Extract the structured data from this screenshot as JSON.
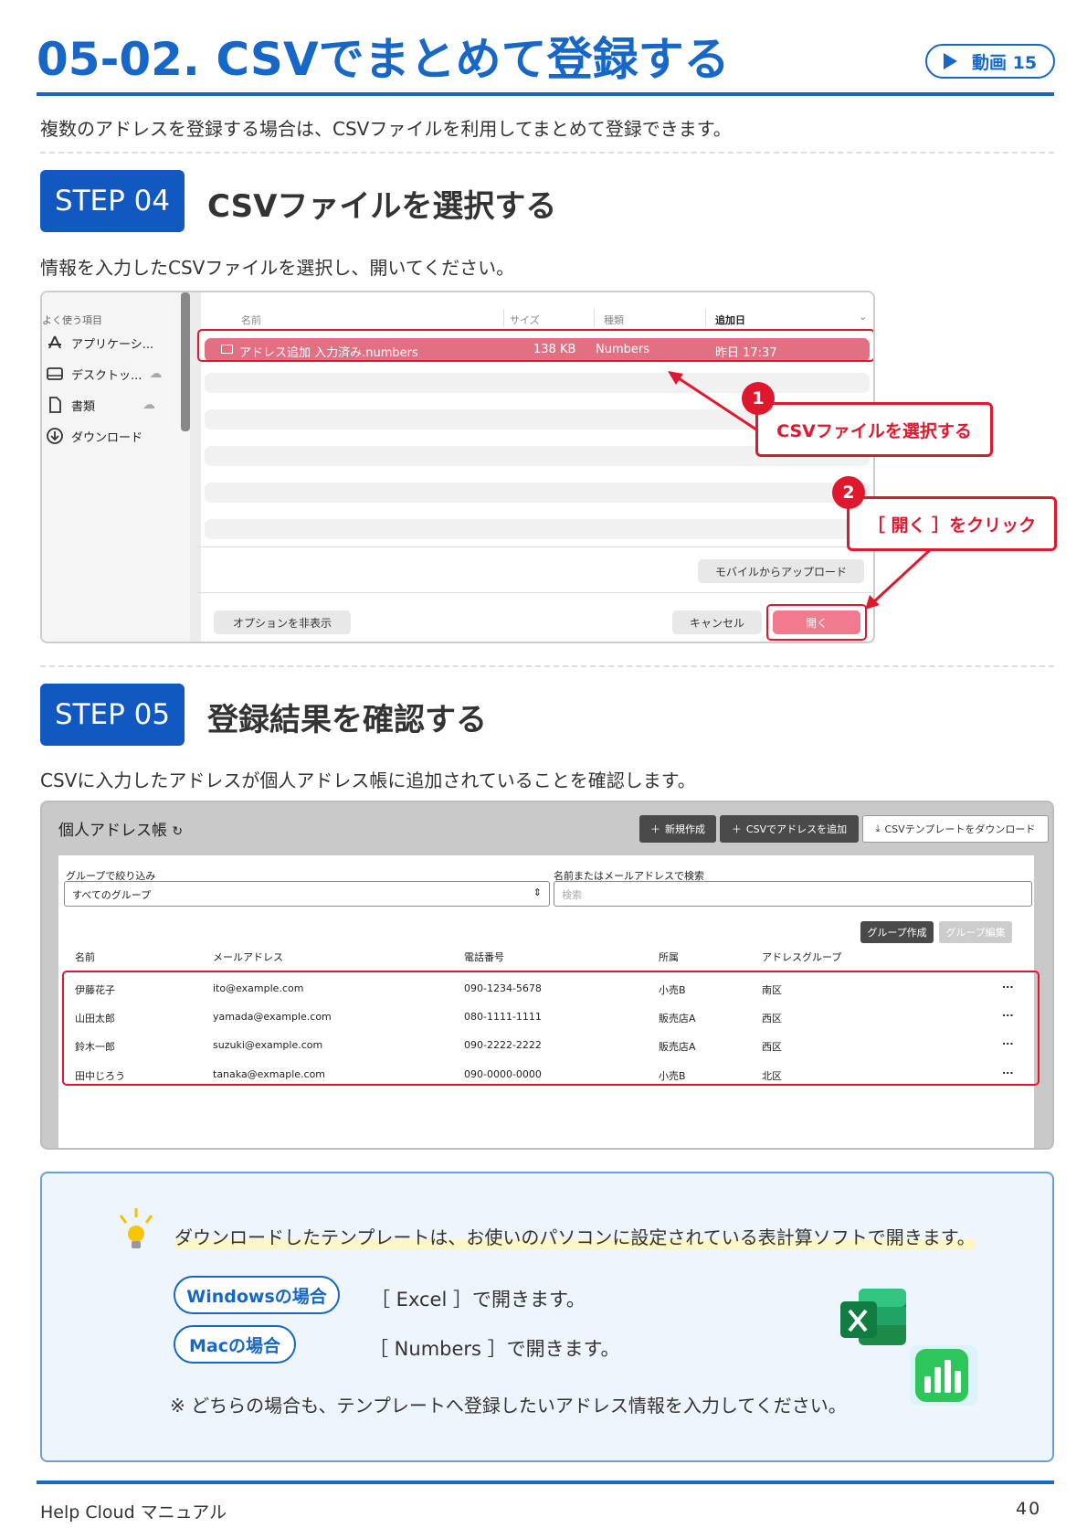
{
  "header": {
    "title": "05-02. CSVでまとめて登録する",
    "video_badge": "動画 15",
    "intro": "複数のアドレスを登録する場合は、CSVファイルを利用してまとめて登録できます。"
  },
  "step4": {
    "badge": "STEP 04",
    "title": "CSVファイルを選択する",
    "desc": "情報を入力したCSVファイルを選択し、開いてください。",
    "dialog": {
      "sidebar_heading": "よく使う項目",
      "sidebar_items": [
        "アプリケーシ...",
        "デスクトッ...",
        "書類",
        "ダウンロード"
      ],
      "columns": [
        "名前",
        "サイズ",
        "種類",
        "追加日"
      ],
      "file": {
        "name": "アドレス追加 入力済み.numbers",
        "size": "138 KB",
        "kind": "Numbers",
        "date": "昨日 17:37"
      },
      "mobile_upload": "モバイルからアップロード",
      "hide_options": "オプションを非表示",
      "cancel": "キャンセル",
      "open": "開く"
    },
    "callouts": [
      {
        "num": "1",
        "text": "CSVファイルを選択する"
      },
      {
        "num": "2",
        "text": "［ 開く ］をクリック"
      }
    ]
  },
  "step5": {
    "badge": "STEP 05",
    "title": "登録結果を確認する",
    "desc": "CSVに入力したアドレスが個人アドレス帳に追加されていることを確認します。",
    "addressbook": {
      "title": "個人アドレス帳",
      "btn_new": "新規作成",
      "btn_csv_add": "CSVでアドレスを追加",
      "btn_csv_template": "CSVテンプレートをダウンロード",
      "filter_label": "グループで絞り込み",
      "filter_value": "すべてのグループ",
      "search_label": "名前またはメールアドレスで検索",
      "search_placeholder": "検索",
      "btn_group_create": "グループ作成",
      "btn_group_edit": "グループ編集",
      "columns": [
        "名前",
        "メールアドレス",
        "電話番号",
        "所属",
        "アドレスグループ"
      ],
      "rows": [
        {
          "name": "伊藤花子",
          "email": "ito@example.com",
          "phone": "090-1234-5678",
          "org": "小売B",
          "group": "南区",
          "more": "..."
        },
        {
          "name": "山田太郎",
          "email": "yamada@example.com",
          "phone": "080-1111-1111",
          "org": "販売店A",
          "group": "西区",
          "more": "..."
        },
        {
          "name": "鈴木一郎",
          "email": "suzuki@example.com",
          "phone": "090-2222-2222",
          "org": "販売店A",
          "group": "西区",
          "more": "..."
        },
        {
          "name": "田中じろう",
          "email": "tanaka@exmaple.com",
          "phone": "090-0000-0000",
          "org": "小売B",
          "group": "北区",
          "more": "..."
        }
      ]
    }
  },
  "tip": {
    "main": "ダウンロードしたテンプレートは、お使いのパソコンに設定されている表計算ソフトで開きます。",
    "windows_label": "Windowsの場合",
    "windows_text": "［ Excel ］で開きます。",
    "mac_label": "Macの場合",
    "mac_text": "［ Numbers ］で開きます。",
    "note": "※ どちらの場合も、テンプレートへ登録したいアドレス情報を入力してください。"
  },
  "footer": {
    "left": "Help Cloud マニュアル",
    "page": "40"
  },
  "colors": {
    "brand_blue": "#1667c8",
    "accent_red": "#e0182d",
    "selection_pink": "#e27083"
  }
}
